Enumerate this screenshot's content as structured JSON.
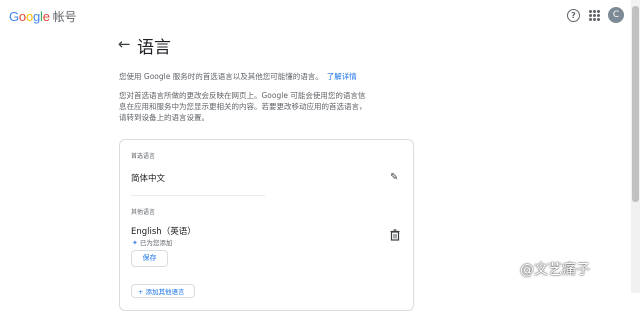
{
  "header": {
    "logo_letters": [
      "G",
      "o",
      "o",
      "g",
      "l",
      "e"
    ],
    "account_label": "帐号",
    "avatar_letter": "C"
  },
  "page": {
    "title": "语言",
    "intro_text": "您使用 Google 服务时的首选语言以及其他您可能懂的语言。",
    "learn_more": "了解详情",
    "description": "您对首选语言所做的更改会反映在网页上。Google 可能会使用您的语言信息在应用和服务中为您显示更相关的内容。若要更改移动应用的首选语言，请转到设备上的语言设置。"
  },
  "card": {
    "preferred_label": "首选语言",
    "preferred_language": "简体中文",
    "other_label": "其他语言",
    "other_language": "English（英语）",
    "added_note": "已为您添加",
    "save_label": "保存",
    "add_label": "+ 添加其他语言"
  },
  "watermark": "@文艺痛子",
  "icons": {
    "back": "arrow-left-icon",
    "help": "help-circle-icon",
    "apps": "apps-grid-icon",
    "edit": "pencil-icon",
    "delete": "trash-icon",
    "spark": "sparkle-icon"
  }
}
